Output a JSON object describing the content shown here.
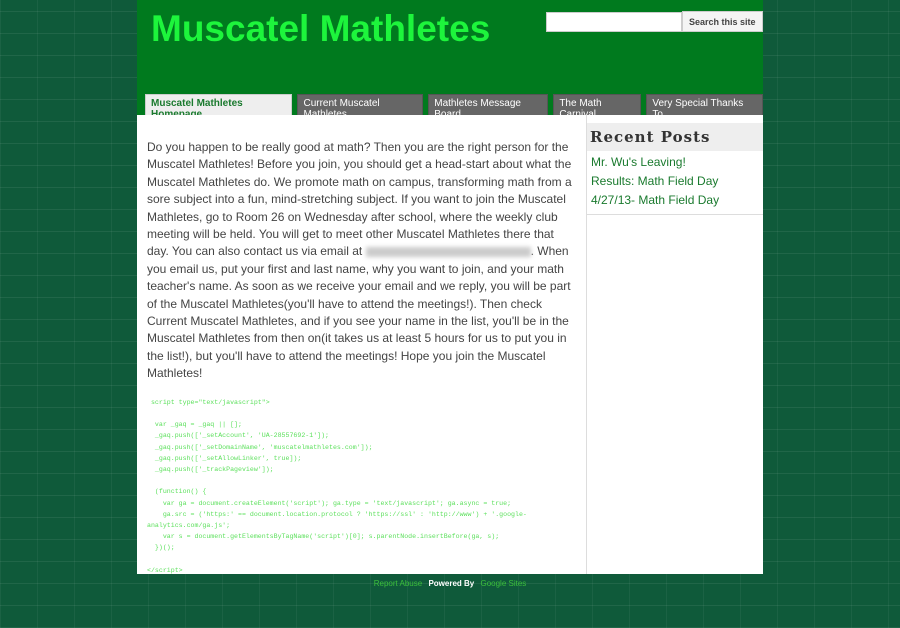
{
  "site_title": "Muscatel Mathletes",
  "search": {
    "placeholder": "",
    "button": "Search this site"
  },
  "nav": [
    "Muscatel Mathletes Homepage",
    "Current Muscatel Mathletes",
    "Mathletes Message Board",
    "The Math Carnival",
    "Very Special Thanks To..."
  ],
  "body": {
    "p1": "Do you happen to be really good at math? Then you are the right person for the Muscatel Mathletes! Before you join, you should get a head-start about what the Muscatel Mathletes do. We promote math on campus, transforming math from a sore subject into a fun, mind-stretching subject. If you want to join the Muscatel Mathletes, go to Room 26 on Wednesday after school, where the weekly club meeting will be held. You will get to meet other Muscatel Mathletes there that day. You can also contact us via email at ",
    "p2": ". When you email us, put your first and last name, why you want to join, and your math teacher's name. As soon as we receive your email and we reply, you will be part of the Muscatel Mathletes(you'll have to attend the meetings!). Then check Current Muscatel Mathletes, and if you see your name in the list, you'll be in the Muscatel Mathletes from then on(it takes us at least 5 hours for us to put you in the list!), but you'll have to attend the meetings! Hope you join the Muscatel Mathletes!",
    "code": " script type=\"text/javascript\">\n\n  var _gaq = _gaq || [];\n  _gaq.push(['_setAccount', 'UA-28557692-1']);\n  _gaq.push(['_setDomainName', 'muscatelmathletes.com']);\n  _gaq.push(['_setAllowLinker', true]);\n  _gaq.push(['_trackPageview']);\n\n  (function() {\n    var ga = document.createElement('script'); ga.type = 'text/javascript'; ga.async = true;\n    ga.src = ('https:' == document.location.protocol ? 'https://ssl' : 'http://www') + '.google-\nanalytics.com/ga.js';\n    var s = document.getElementsByTagName('script')[0]; s.parentNode.insertBefore(ga, s);\n  })();\n\n</script>"
  },
  "sidebar": {
    "heading": "Recent Posts",
    "posts": [
      "Mr. Wu's Leaving!",
      "Results: Math Field Day",
      "4/27/13- Math Field Day"
    ]
  },
  "footer": {
    "left": "Report Abuse",
    "powered": "Powered By",
    "right": "Google Sites"
  }
}
